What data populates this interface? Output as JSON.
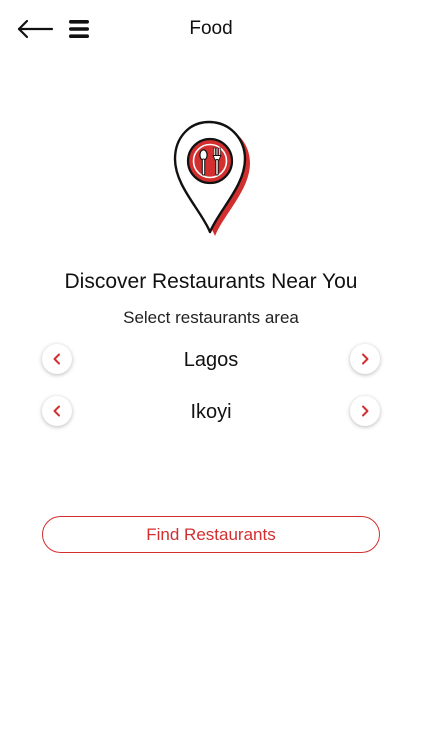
{
  "header": {
    "title": "Food",
    "back_icon": "arrow-left-icon",
    "menu_icon": "hamburger-menu-icon"
  },
  "hero": {
    "icon": "restaurant-location-pin-icon"
  },
  "headline": "Discover Restaurants Near You",
  "subline": "Select restaurants area",
  "selectors": {
    "city": {
      "value": "Lagos",
      "prev_icon": "chevron-left-icon",
      "next_icon": "chevron-right-icon"
    },
    "area": {
      "value": "Ikoyi",
      "prev_icon": "chevron-left-icon",
      "next_icon": "chevron-right-icon"
    }
  },
  "find_button": {
    "label": "Find Restaurants"
  },
  "colors": {
    "accent": "#d32f2f",
    "text": "#111111",
    "background": "#ffffff"
  }
}
